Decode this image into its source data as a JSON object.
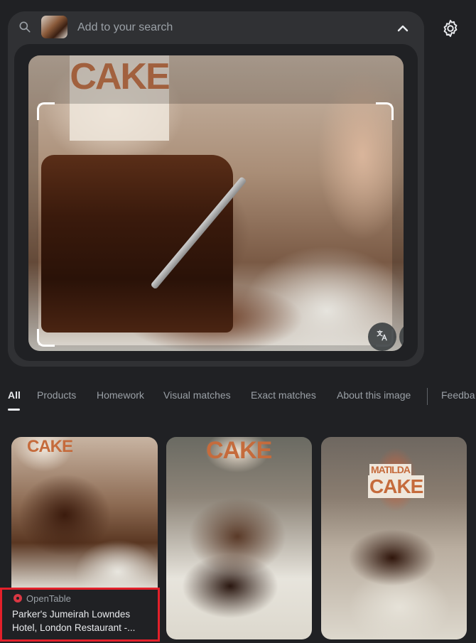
{
  "search": {
    "placeholder": "Add to your search",
    "icon": "search-icon",
    "collapse_icon": "chevron-up-icon"
  },
  "settings": {
    "icon": "gear-icon"
  },
  "preview": {
    "sign_text": "CAKE",
    "translate_icon": "translate-icon",
    "fullscreen_icon": "fullscreen-icon"
  },
  "tabs": [
    {
      "label": "All",
      "active": true
    },
    {
      "label": "Products"
    },
    {
      "label": "Homework"
    },
    {
      "label": "Visual matches"
    },
    {
      "label": "Exact matches"
    },
    {
      "label": "About this image"
    },
    {
      "label": "Feedba"
    }
  ],
  "results": [
    {
      "sign": "CAKE",
      "source": "OpenTable",
      "source_icon": "opentable-icon",
      "title": "Parker's Jumeirah Lowndes Hotel, London Restaurant -..."
    },
    {
      "sign": "CAKE"
    },
    {
      "sign_top": "MATILDA",
      "sign": "CAKE"
    }
  ],
  "colors": {
    "background": "#202124",
    "panel": "#303134",
    "highlight": "#e3202a",
    "opentable": "#da3743"
  }
}
